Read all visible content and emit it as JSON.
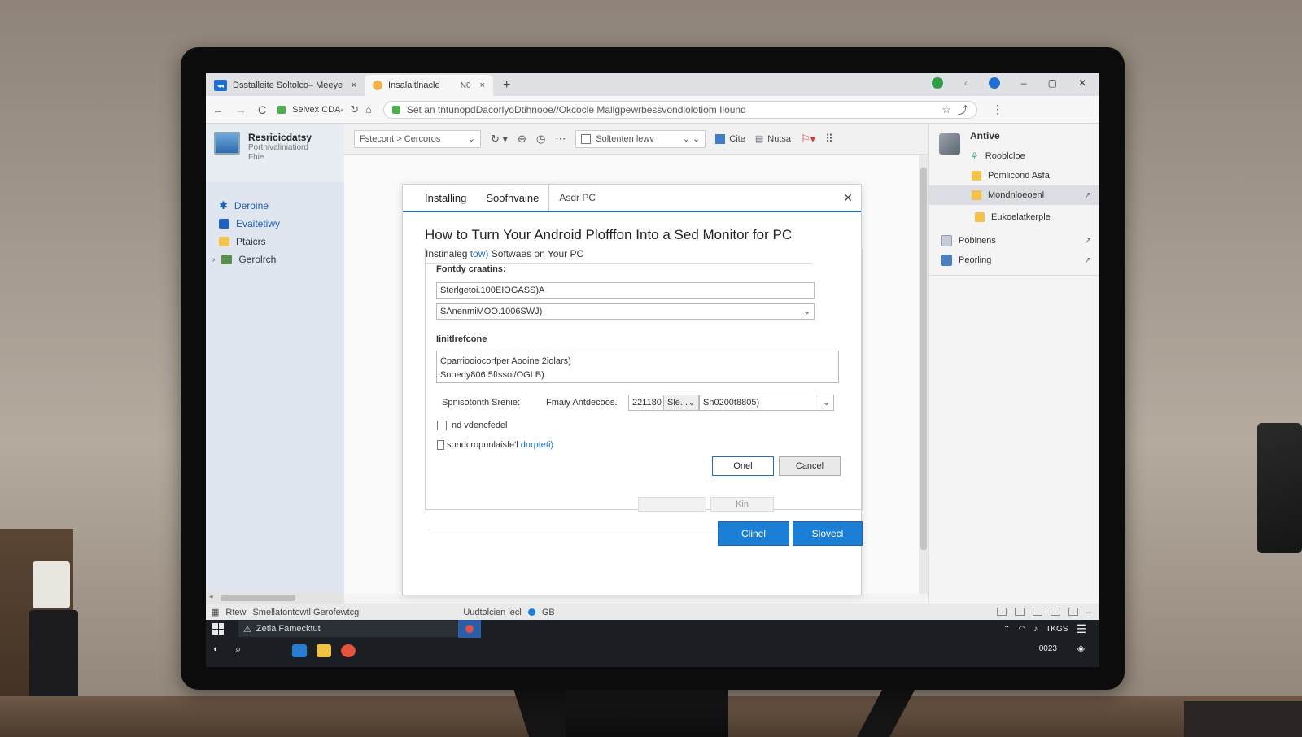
{
  "browser": {
    "tabs": [
      {
        "label": "Dsstalleite Soltolco– Meeye",
        "icon": "app-icon",
        "close": "×"
      },
      {
        "label": "Insalaitlnacle",
        "extra": "N0",
        "icon": "dot-icon",
        "close": "×"
      }
    ],
    "new_tab": "+",
    "window_controls": {
      "minimize": "–",
      "maximize": "▢",
      "close": "✕"
    },
    "address": {
      "back": "←",
      "forward": "→",
      "reload": "C",
      "chip": "Selvex CDA-",
      "url": "Set an tntunopdDacorlyoDtihnooe//Okcocle Mallgpewrbessvondlolotiom Ilound"
    }
  },
  "sidebar": {
    "header_title": "Resricicdatsy",
    "header_sub": "Porthivaliniatiord",
    "header_sub2": "Fhie",
    "items": [
      {
        "label": "Deroine",
        "color": "#1d5fb4",
        "icon": "pin-icon"
      },
      {
        "label": "Evaitetiwy",
        "color": "#2060c0",
        "icon": "check-icon"
      },
      {
        "label": "Ptaicrs",
        "color": "#f3c34e",
        "icon": "folder-icon"
      },
      {
        "label": "Gerolrch",
        "color": "#5a8f4e",
        "icon": "drive-icon"
      }
    ]
  },
  "toolbar": {
    "breadcrumb": "Fstecont > Cercoros",
    "sort_dropdown": "Soltenten lewv",
    "btn_cite": "Cite",
    "btn_nutsa": "Nutsa"
  },
  "dialog": {
    "tab_active": "Installing",
    "tab_second": "Soofhvaine",
    "tab_path": "Asdr PC",
    "close": "✕",
    "title": "How to Turn Your Android Plofffon Into a Sed Monitor for PC",
    "subhead_pre": "Instinaleg ",
    "subhead_link": "tow)",
    "subhead_post": " Softwaes on Your PC",
    "label1": "Fontdy craatins:",
    "field1": "Sterlgetoi.100EIOGASS)A",
    "field2": "SAnenmiMOO.1006SWJ)",
    "label2": "Iinitlrefcone",
    "area_line1": "Cparriooiocorfper Aooine 2iolars)",
    "area_line2": "Snoedy806.5ftssoi/OGI B)",
    "row_label1": "Spnisotonth Srenie:",
    "row_label2": "Fmaiy Antdecoos.",
    "num_field": "221180",
    "sel_field": "Sle...",
    "value_field": "Sn0200t8805)",
    "checkbox1": "nd vdencfedel",
    "checkbox2_pre": "sondcropunlaisfe'l",
    "checkbox2_link": "dnrpteti)",
    "btn_ok": "Onel",
    "btn_cancel": "Cancel",
    "btn_faint": "Kin",
    "btn_blue1": "Clinel",
    "btn_blue2": "Slovecl"
  },
  "rightpane": {
    "head": "Antive",
    "items": [
      {
        "label": "Rooblcloe",
        "icon": "users-icon"
      },
      {
        "label": "Pomlicond Asfa",
        "icon": "folder-icon"
      },
      {
        "label": "Mondnloeoenl",
        "icon": "folder-icon",
        "selected": true
      },
      {
        "label": "Eukoelatkerple",
        "icon": "folder-icon"
      },
      {
        "label": "Pobinens",
        "icon": "doc-icon"
      },
      {
        "label": "Peorling",
        "icon": "image-icon"
      }
    ]
  },
  "statusbar": {
    "left": "Rtew",
    "middle": "Smellatontowtl Gerofewtcg",
    "right": "Uudtolcien lecl",
    "right2": "GB"
  },
  "taskbar": {
    "search": "Zetla Famecktut",
    "time": "TKGS",
    "date": "0023"
  }
}
